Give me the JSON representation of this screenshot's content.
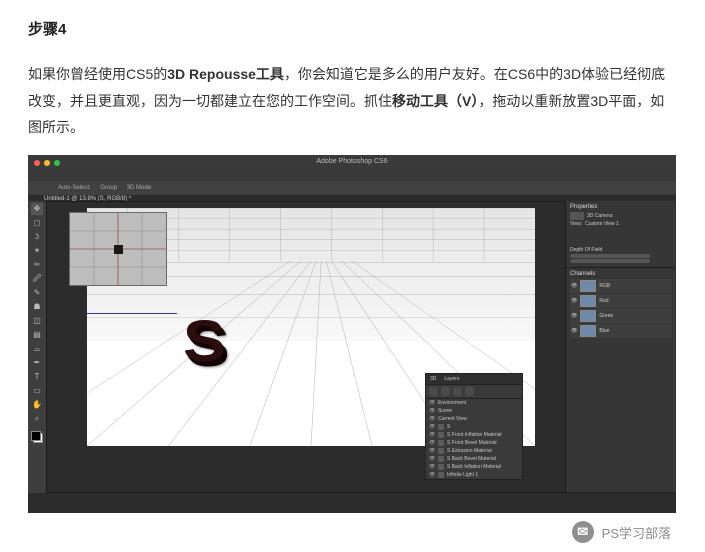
{
  "article": {
    "heading": "步骤4",
    "p1_a": "如果你曾经使用CS5的",
    "p1_b": "3D Repousse工具",
    "p1_c": "，你会知道它是多么的用户友好。在CS6中的3D体验已经彻底改变，并且更直观，因为一切都建立在您的工作空间。抓住",
    "p1_d": "移动工具（V）",
    "p1_e": "，拖动以重新放置3D平面，如图所示。"
  },
  "app": {
    "title": "Adobe Photoshop CS6",
    "doc_tab": "Untitled-1 @ 13.8% (S, RGB/8) *",
    "options_bar": {
      "mode_label": "3D Mode:",
      "auto": "Auto-Select:",
      "group": "Group"
    },
    "letter3d": "S",
    "float_panel": {
      "tabs": [
        "3D",
        "Layers"
      ],
      "sections": [
        "Environment",
        "Scene",
        "Current View"
      ],
      "items": [
        "S",
        "S Front Inflation Material",
        "S Front Bevel Material",
        "S Extrusion Material",
        "S Back Bevel Material",
        "S Back Inflation Material",
        "Infinite Light 1"
      ]
    },
    "right_panels": {
      "properties": "Properties",
      "prop_sub": "3D Camera",
      "view_label": "View:",
      "view_value": "Custom View 1",
      "dof": "Depth Of Field",
      "channels": "Channels",
      "ch_items": [
        "RGB",
        "Red",
        "Green",
        "Blue"
      ]
    }
  },
  "watermark": {
    "text": "PS学习部落"
  }
}
